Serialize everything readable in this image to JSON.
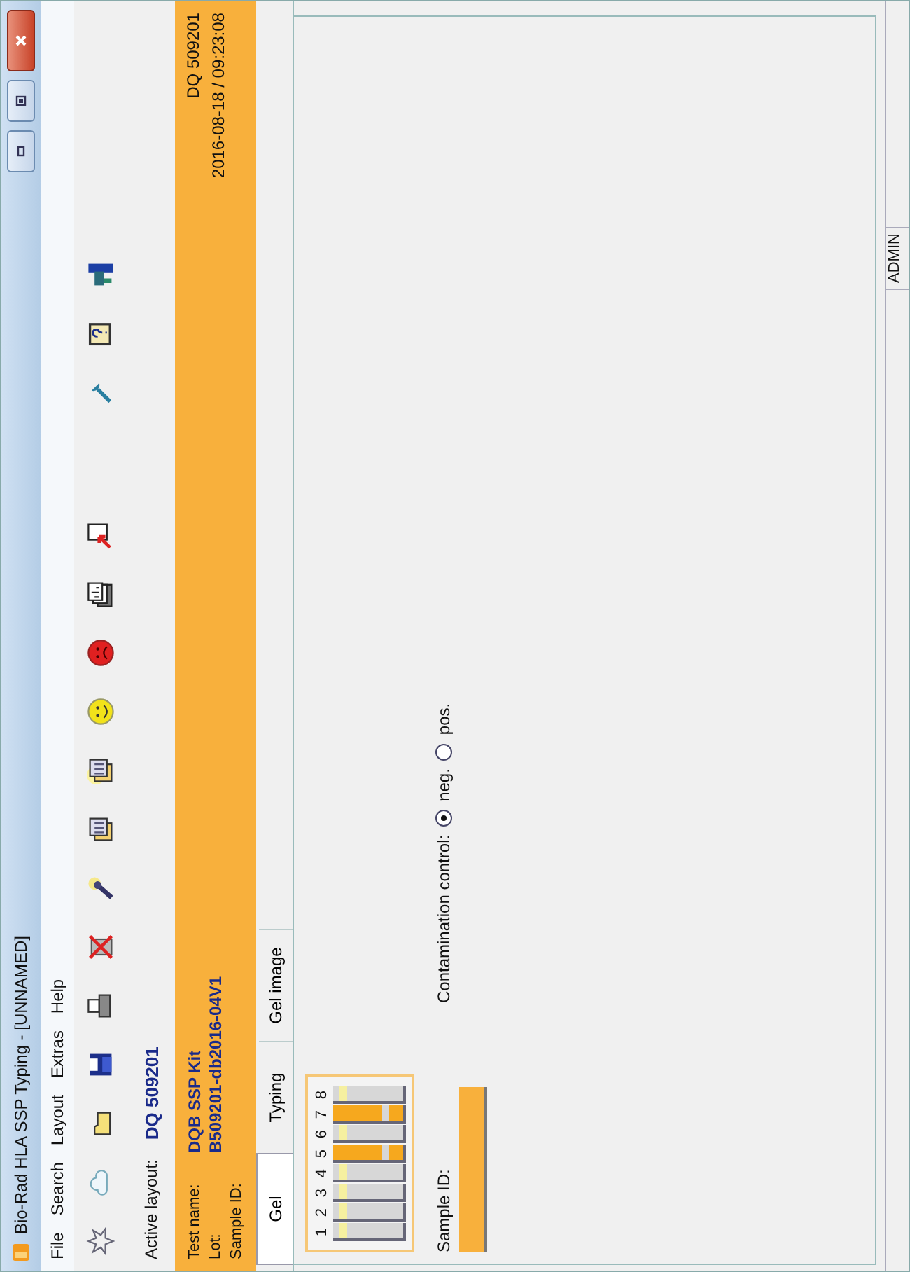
{
  "window": {
    "title": "Bio-Rad HLA SSP Typing - [UNNAMED]"
  },
  "menu": [
    "File",
    "Search",
    "Layout",
    "Extras",
    "Help"
  ],
  "active_layout": {
    "label": "Active layout:",
    "value": "DQ 509201"
  },
  "header": {
    "fields": [
      {
        "label": "Test name:",
        "value": "DQB SSP Kit"
      },
      {
        "label": "Lot:",
        "value": "B509201-db2016-04V1"
      },
      {
        "label": "Sample ID:"
      }
    ],
    "code": "DQ 509201",
    "timestamp": "2016-08-18 / 09:23:08"
  },
  "tabs": [
    {
      "label": "Gel",
      "selected": true
    },
    {
      "label": "Typing",
      "selected": false
    },
    {
      "label": "Gel image",
      "selected": false
    }
  ],
  "gel": {
    "lanes": [
      {
        "number": "1",
        "positive": false
      },
      {
        "number": "2",
        "positive": false
      },
      {
        "number": "3",
        "positive": false
      },
      {
        "number": "4",
        "positive": false
      },
      {
        "number": "5",
        "positive": true
      },
      {
        "number": "6",
        "positive": false
      },
      {
        "number": "7",
        "positive": true
      },
      {
        "number": "8",
        "positive": false
      }
    ]
  },
  "sample_id": {
    "label": "Sample ID:"
  },
  "contamination_control": {
    "label": "Contamination control:",
    "options": [
      {
        "label": "neg.",
        "selected": true
      },
      {
        "label": "pos.",
        "selected": false
      }
    ]
  },
  "status_bar": {
    "user": "ADMIN"
  }
}
